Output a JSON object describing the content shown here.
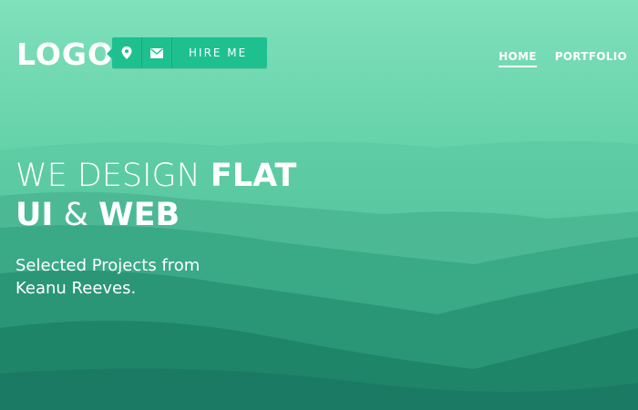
{
  "brand": {
    "logo_text": "LOGO"
  },
  "contact_bar": {
    "location_icon": "map-pin-icon",
    "email_icon": "envelope-icon",
    "hire_label": "HIRE ME"
  },
  "nav": {
    "items": [
      {
        "label": "HOME",
        "active": true
      },
      {
        "label": "PORTFOLIO",
        "active": false
      }
    ]
  },
  "hero": {
    "headline_line1_light": "WE DESIGN",
    "headline_line1_bold": "FLAT",
    "headline_line2_bold1": "UI",
    "headline_line2_amp": "&",
    "headline_line2_bold2": "WEB",
    "subtitle": "Selected Projects from Keanu Reeves."
  },
  "colors": {
    "sky_top": "#7fe0bc",
    "accent": "#1fc08f",
    "mountain_dark": "#1b7a63"
  }
}
